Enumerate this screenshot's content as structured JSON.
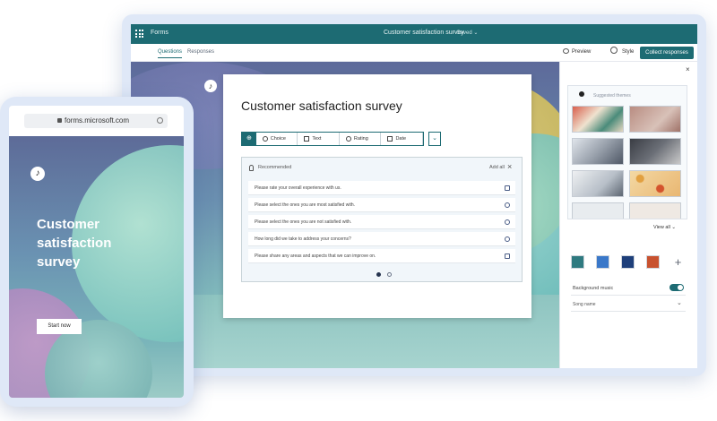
{
  "app_bar": {
    "app_name": "Forms",
    "doc_title": "Customer satisfaction survey",
    "doc_state": "· Saved ⌄"
  },
  "command_bar": {
    "tabs": [
      {
        "label": "Questions",
        "active": true
      },
      {
        "label": "Responses",
        "active": false
      }
    ],
    "preview_label": "Preview",
    "style_label": "Style",
    "collect_label": "Collect responses"
  },
  "survey": {
    "title": "Customer satisfaction survey",
    "question_types": [
      {
        "label": "Choice",
        "icon": "radio-icon"
      },
      {
        "label": "Text",
        "icon": "text-icon"
      },
      {
        "label": "Rating",
        "icon": "rating-icon"
      },
      {
        "label": "Date",
        "icon": "date-icon"
      }
    ],
    "add_label": "⊕",
    "more_label": "⌄",
    "recommended": {
      "label": "Recommended",
      "add_all_label": "Add all",
      "items": [
        {
          "text": "Please rate your overall experience with us.",
          "icon": "rating-icon"
        },
        {
          "text": "Please select the ones you are most satisfied with.",
          "icon": "choice-icon"
        },
        {
          "text": "Please select the ones you are not satisfied with.",
          "icon": "choice-icon"
        },
        {
          "text": "How long did we take to address your concerns?",
          "icon": "choice-icon"
        },
        {
          "text": "Please share any areas and aspects that we can improve on.",
          "icon": "text-icon"
        }
      ],
      "page_dots": 2,
      "active_dot": 0
    }
  },
  "style_pane": {
    "close_label": "×",
    "themes_hint": "Suggested themes",
    "view_all_label": "View all ⌄",
    "swatches": [
      "#2f7a80",
      "#3a78c9",
      "#1e3f7a",
      "#c8522f"
    ],
    "add_swatch_label": "+",
    "background_music_label": "Background music",
    "background_music_on": true,
    "track_label": "Song name",
    "track_chevron": "⌄"
  },
  "phone": {
    "url": "forms.microsoft.com",
    "hero_title": "Customer satisfaction survey",
    "start_label": "Start now",
    "music_label": "♪"
  },
  "canvas": {
    "music_label": "♪"
  }
}
